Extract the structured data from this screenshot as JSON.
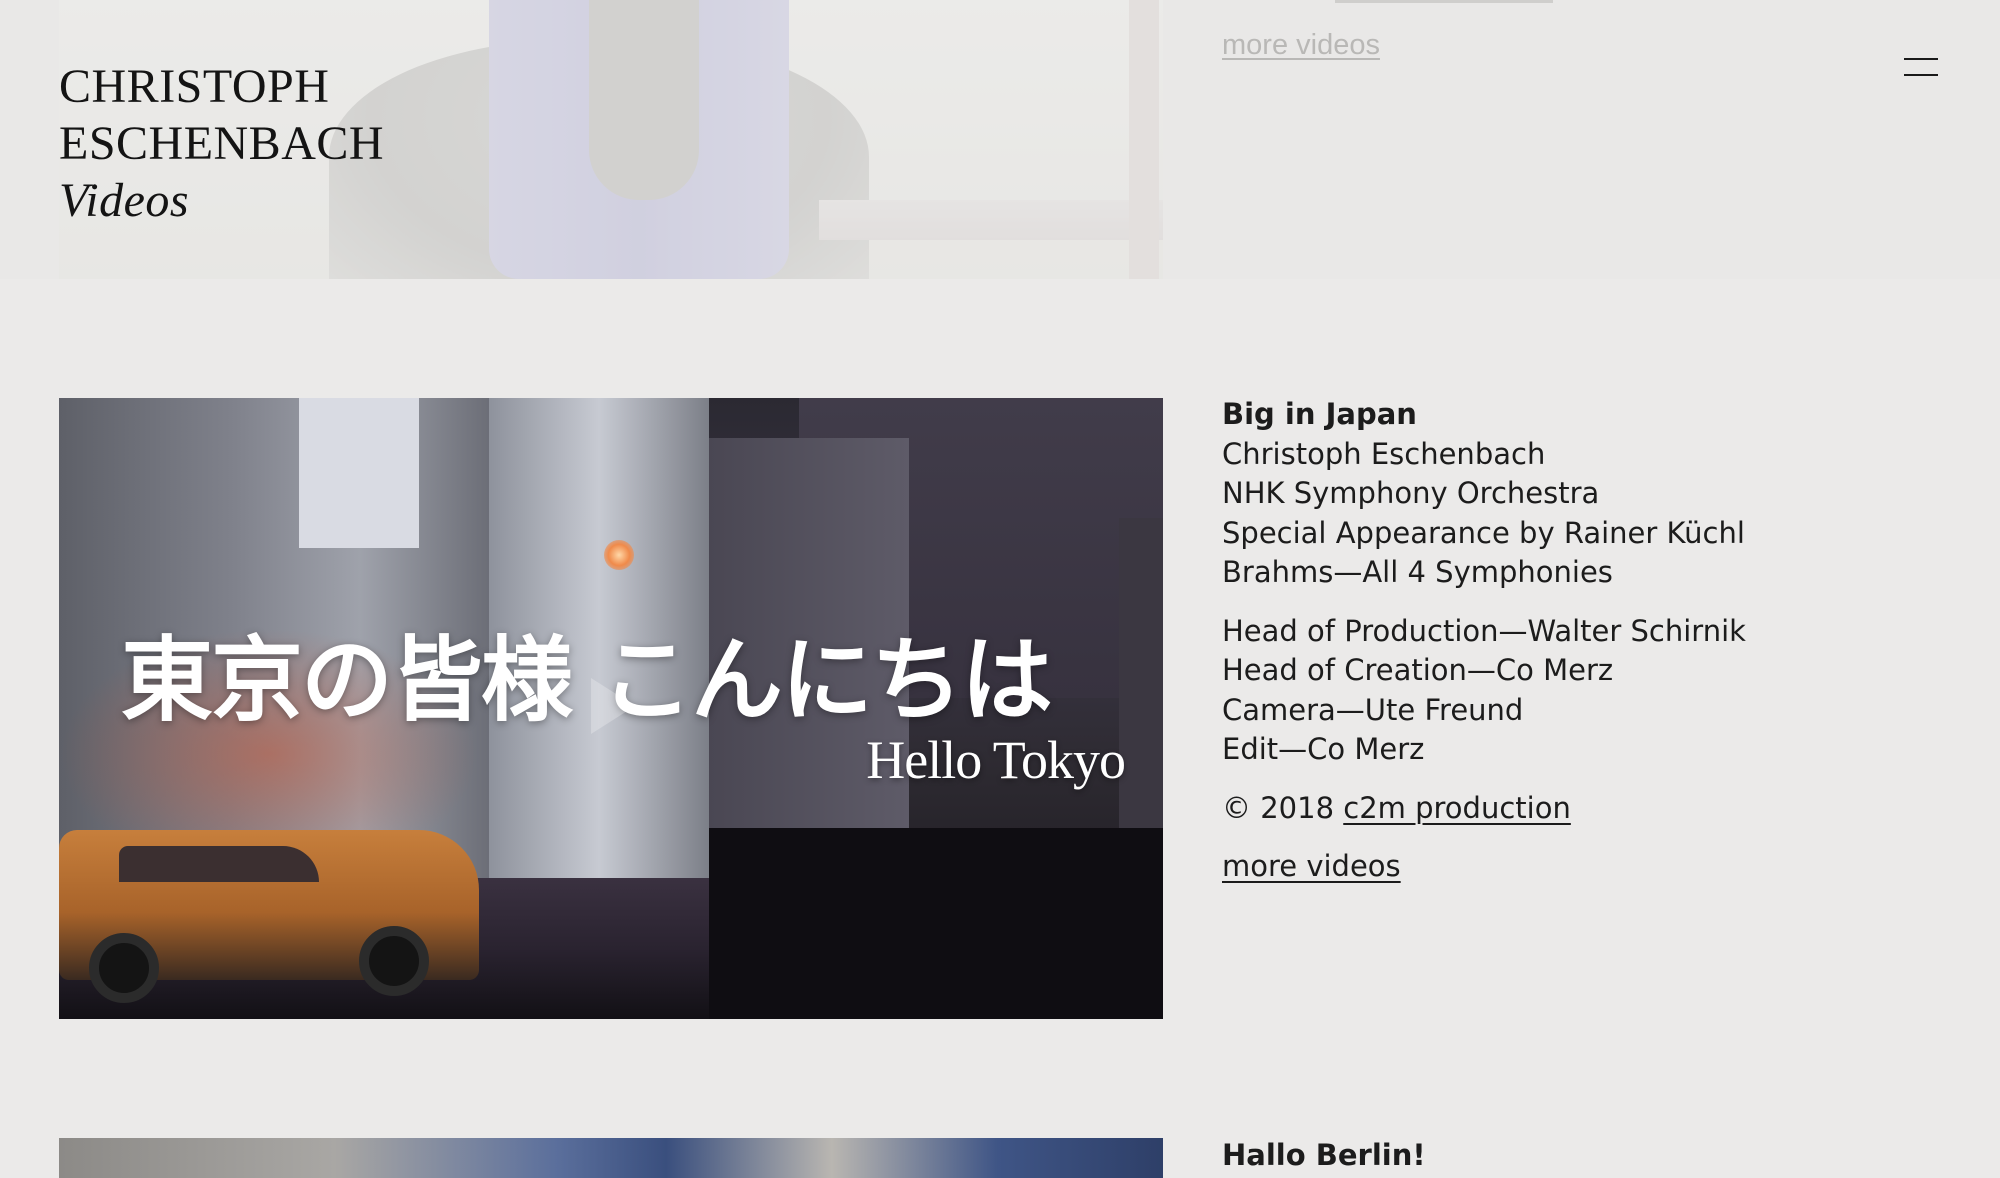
{
  "brand": {
    "line1": "CHRISTOPH",
    "line2": "ESCHENBACH",
    "section": "Videos"
  },
  "header": {
    "menu_icon": "hamburger-menu-icon"
  },
  "previous_entry": {
    "more_videos_label": "more videos"
  },
  "current_entry": {
    "video": {
      "overlay_title_japanese": "東京の皆様 こんにちは",
      "overlay_title_english": "Hello Tokyo",
      "play_icon": "play-icon"
    },
    "title": "Big in Japan",
    "details": [
      "Christoph Eschenbach",
      "NHK Symphony Orchestra",
      "Special Appearance by Rainer Küchl",
      "Brahms—All 4 Symphonies"
    ],
    "credits": [
      "Head of Production—Walter Schirnik",
      "Head of Creation—Co Merz",
      "Camera—Ute Freund",
      "Edit—Co Merz"
    ],
    "copyright_prefix": "© 2018",
    "copyright_link": "c2m production",
    "more_videos_label": "more videos"
  },
  "next_entry": {
    "title": "Hallo Berlin!"
  }
}
